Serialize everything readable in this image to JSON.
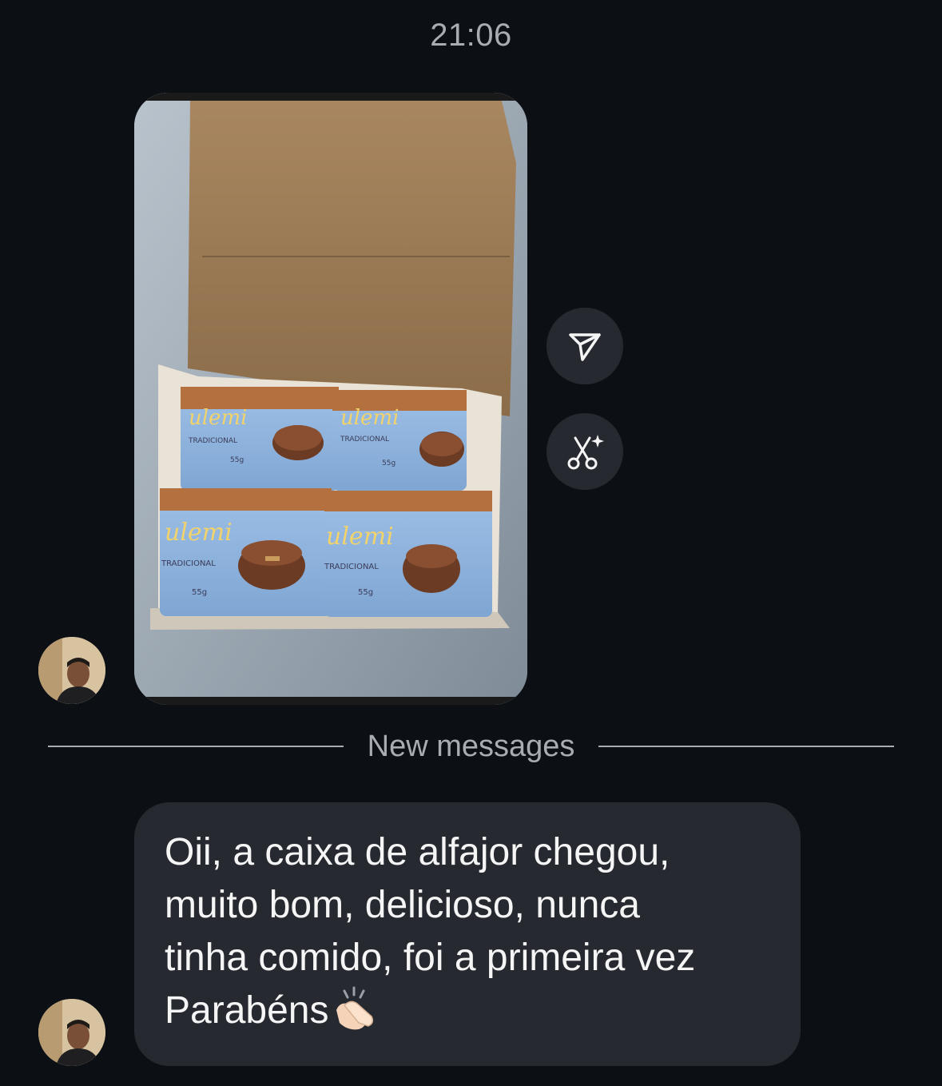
{
  "thread": {
    "timestamp": "21:06",
    "divider_label": "New messages"
  },
  "media_message": {
    "image_description_icon": "photo-of-alfajor-box",
    "product_brand_text": "ulemi",
    "product_flavor_text": "TRADICIONAL",
    "product_weight_text": "55g"
  },
  "actions": {
    "share_icon": "send-icon",
    "remix_icon": "remix-scissors-icon"
  },
  "text_message": {
    "text": "Oii, a caixa de alfajor chegou,\nmuito bom, delicioso, nunca\ntinha comido, foi a primeira vez\nParabéns",
    "emoji": "clapping-hands-icon"
  },
  "colors": {
    "background": "#0c1014",
    "bubble": "#262a30",
    "secondary_text": "#a8acb3",
    "primary_text": "#f5f5f5"
  }
}
